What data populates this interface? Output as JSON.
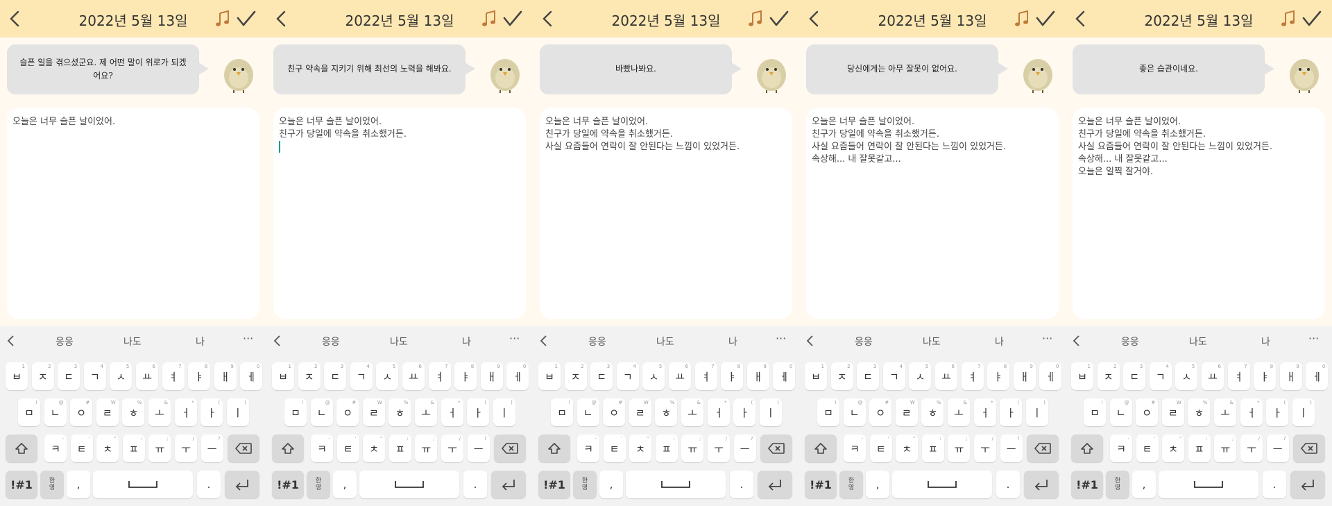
{
  "header": {
    "date": "2022년 5월 13일"
  },
  "screens": [
    {
      "bubble": "슬픈 일을 겪으셨군요. 제 어떤 말이 위로가 되겠어요?",
      "lines": [
        "오늘은 너무 슬픈 날이었어."
      ],
      "caret": false
    },
    {
      "bubble": "친구 약속을 지키기 위해 최선의 노력을 해봐요.",
      "lines": [
        "오늘은 너무 슬픈 날이었어.",
        "친구가 당일에 약속을 취소했거든."
      ],
      "caret": true
    },
    {
      "bubble": "바빴나봐요.",
      "lines": [
        "오늘은 너무 슬픈 날이었어.",
        "친구가 당일에 약속을 취소했거든.",
        "사실 요즘들어 연락이 잘 안된다는 느낌이 있었거든."
      ],
      "caret": false
    },
    {
      "bubble": "당신에게는 아무 잘못이 없어요.",
      "lines": [
        "오늘은 너무 슬픈 날이었어.",
        "친구가 당일에 약속을 취소했거든.",
        "사실 요즘들어 연락이 잘 안된다는 느낌이 있었거든.",
        "속상해... 내 잘못같고..."
      ],
      "caret": false
    },
    {
      "bubble": "좋은 습관이네요.",
      "lines": [
        "오늘은 너무 슬픈 날이었어.",
        "친구가 당일에 약속을 취소했거든.",
        "사실 요즘들어 연락이 잘 안된다는 느낌이 있었거든.",
        "속상해... 내 잘못같고...",
        "오늘은 일찍 잘거야."
      ],
      "caret": false
    }
  ],
  "keyboard": {
    "suggestions": [
      "응응",
      "나도",
      "나"
    ],
    "more": "···",
    "row1": [
      {
        "k": "ㅂ",
        "h": "1"
      },
      {
        "k": "ㅈ",
        "h": "2"
      },
      {
        "k": "ㄷ",
        "h": "3"
      },
      {
        "k": "ㄱ",
        "h": "4"
      },
      {
        "k": "ㅅ",
        "h": "5"
      },
      {
        "k": "ㅛ",
        "h": "6"
      },
      {
        "k": "ㅕ",
        "h": "7"
      },
      {
        "k": "ㅑ",
        "h": "8"
      },
      {
        "k": "ㅐ",
        "h": "9"
      },
      {
        "k": "ㅔ",
        "h": "0"
      }
    ],
    "row2": [
      {
        "k": "ㅁ",
        "h": "!"
      },
      {
        "k": "ㄴ",
        "h": "@"
      },
      {
        "k": "ㅇ",
        "h": "#"
      },
      {
        "k": "ㄹ",
        "h": "W"
      },
      {
        "k": "ㅎ",
        "h": "%"
      },
      {
        "k": "ㅗ",
        "h": "&"
      },
      {
        "k": "ㅓ",
        "h": "*"
      },
      {
        "k": "ㅏ",
        "h": "("
      },
      {
        "k": "ㅣ",
        "h": ")"
      }
    ],
    "row3": [
      {
        "k": "ㅋ",
        "h": "-"
      },
      {
        "k": "ㅌ",
        "h": "'"
      },
      {
        "k": "ㅊ",
        "h": "\""
      },
      {
        "k": "ㅍ",
        "h": ":"
      },
      {
        "k": "ㅠ",
        "h": ";"
      },
      {
        "k": "ㅜ",
        "h": "/"
      },
      {
        "k": "ㅡ",
        "h": "?"
      }
    ],
    "sym": "!#1",
    "lang_top": "한",
    "lang_bottom": "영",
    "comma": ",",
    "period": "."
  }
}
